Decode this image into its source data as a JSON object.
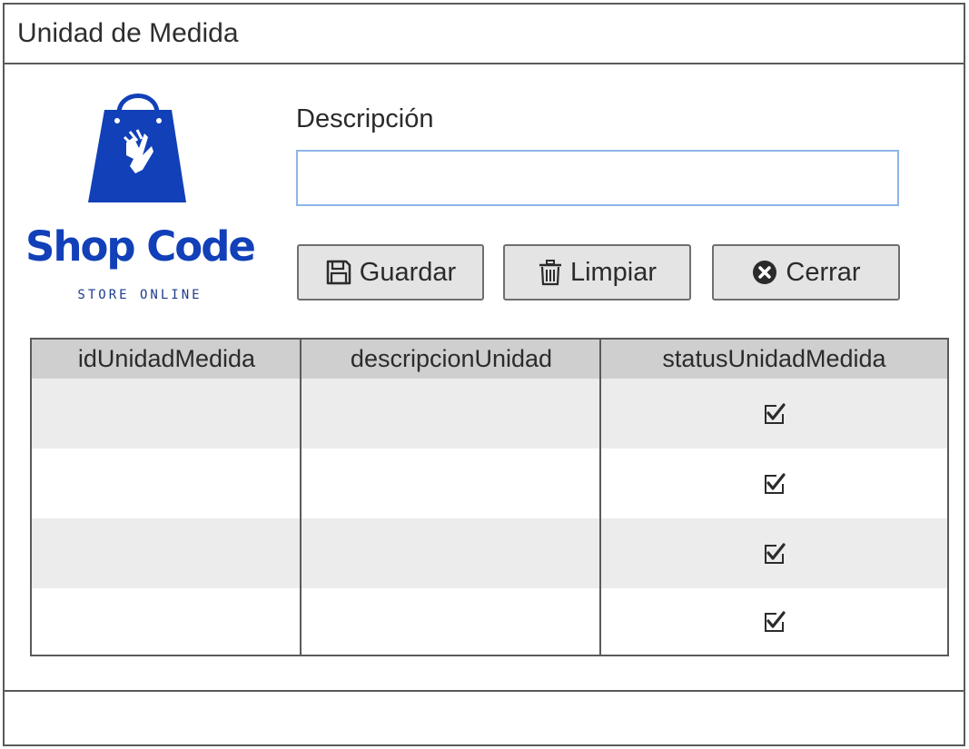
{
  "window": {
    "title": "Unidad de Medida"
  },
  "logo": {
    "name": "Shop Code",
    "tagline": "STORE ONLINE",
    "brand_color": "#1140b8"
  },
  "form": {
    "description_label": "Descripción",
    "description_value": "",
    "description_placeholder": ""
  },
  "buttons": {
    "save": {
      "label": "Guardar",
      "icon": "floppy-disk-icon"
    },
    "clear": {
      "label": "Limpiar",
      "icon": "trash-icon"
    },
    "close": {
      "label": "Cerrar",
      "icon": "close-circle-icon"
    }
  },
  "table": {
    "columns": [
      "idUnidadMedida",
      "descripcionUnidad",
      "statusUnidadMedida"
    ],
    "rows": [
      {
        "id": "",
        "descripcion": "",
        "status": true
      },
      {
        "id": "",
        "descripcion": "",
        "status": true
      },
      {
        "id": "",
        "descripcion": "",
        "status": true
      },
      {
        "id": "",
        "descripcion": "",
        "status": true
      }
    ]
  }
}
